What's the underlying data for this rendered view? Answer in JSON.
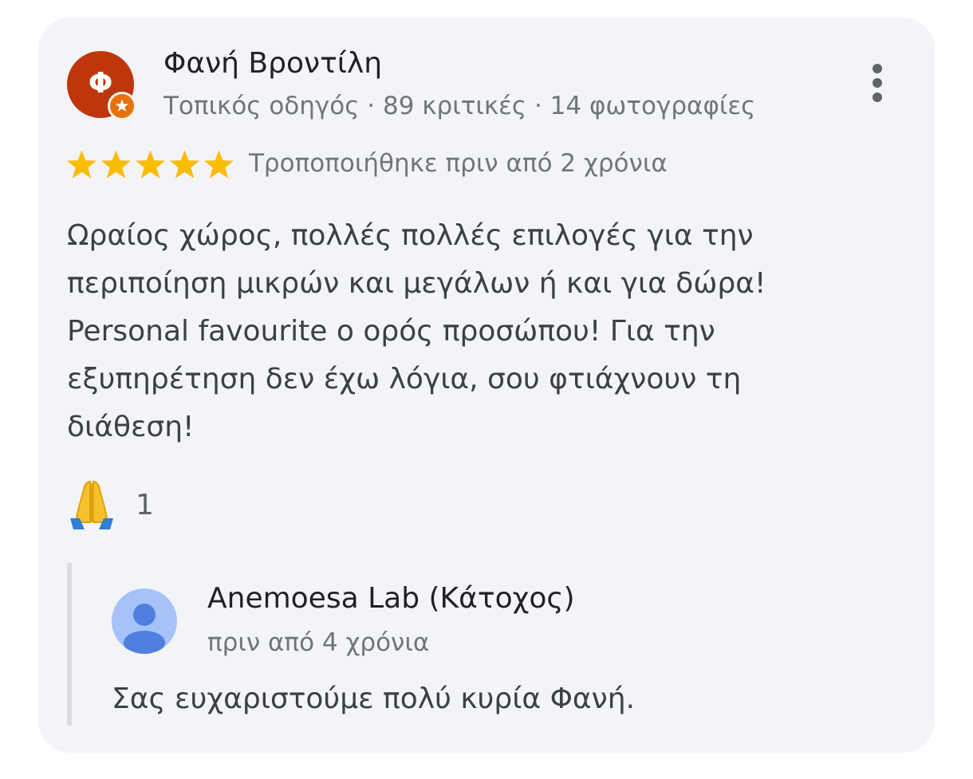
{
  "review": {
    "avatar_letter": "Φ",
    "reviewer_name": "Φανή Βροντίλη",
    "reviewer_meta": "Τοπικός οδηγός · 89 κριτικές · 14 φωτογραφίες",
    "rating": 5,
    "rating_max": 5,
    "modified_date": "Τροποποιήθηκε πριν από 2 χρόνια",
    "text_lines": [
      "Ωραίος χώρος, πολλές πολλές επιλογές για την",
      "περιποίηση μικρών και μεγάλων ή και για δώρα!",
      "Personal favourite ο ορός προσώπου! Για την",
      "εξυπηρέτηση δεν έχω λόγια, σου φτιάχνουν τη",
      "διάθεση!"
    ],
    "reaction_icon": "folded-hands-icon",
    "reaction_count": "1"
  },
  "owner_reply": {
    "name": "Anemoesa Lab (Κάτοχος)",
    "date": "πριν από 4 χρόνια",
    "text": "Σας ευχαριστούμε πολύ κυρία Φανή."
  },
  "colors": {
    "card_background": "#f3f4f7",
    "avatar_background": "#c0360c",
    "local_guide_badge": "#e8710a",
    "star": "#fbbc04",
    "owner_avatar_background": "#a5c3f8",
    "owner_avatar_figure": "#4f7fde"
  }
}
